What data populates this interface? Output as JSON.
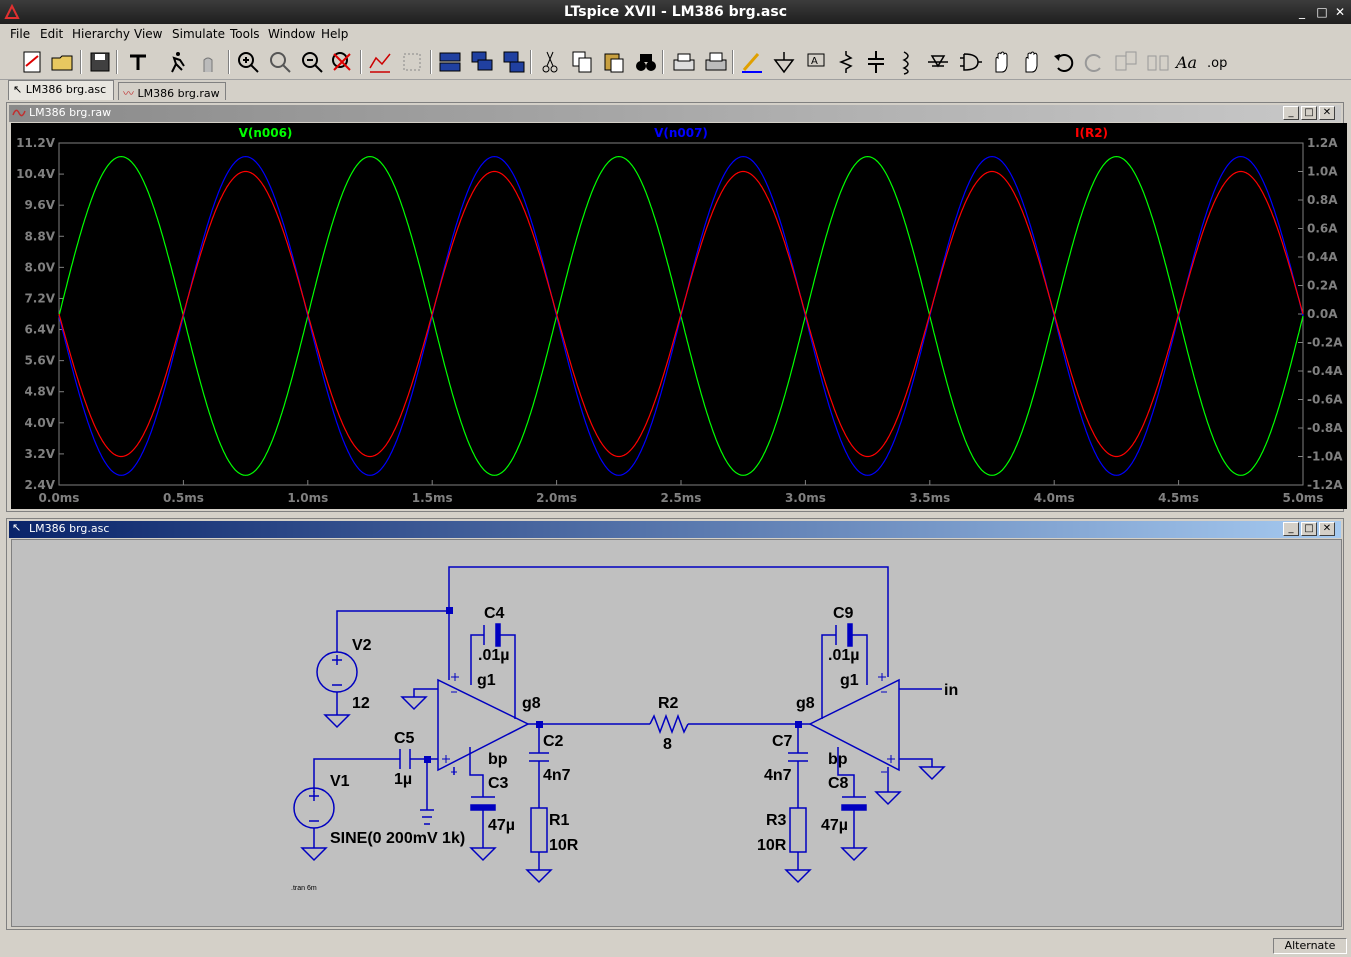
{
  "window": {
    "title": "LTspice XVII - LM386 brg.asc"
  },
  "menu": [
    "File",
    "Edit",
    "Hierarchy",
    "View",
    "Simulate",
    "Tools",
    "Window",
    "Help"
  ],
  "tabs": [
    {
      "label": "LM386 brg.asc",
      "active": true
    },
    {
      "label": "LM386 brg.raw",
      "active": false
    }
  ],
  "toolbar_icons": [
    "new-schematic-icon",
    "open-icon",
    "save-icon",
    "control-panel-icon",
    "run-icon",
    "halt-icon",
    "zoom-in-icon",
    "zoom-fit-icon",
    "zoom-out-icon",
    "zoom-cancel-icon",
    "autorange-icon",
    "delete-plot-icon",
    "tile-horizontal-icon",
    "cascade-icon",
    "tile-vertical-icon",
    "cut-icon",
    "copy-icon",
    "paste-icon",
    "find-icon",
    "print-icon",
    "print-setup-icon",
    "draw-wire-icon",
    "ground-icon",
    "label-net-icon",
    "resistor-icon",
    "capacitor-icon",
    "inductor-icon",
    "diode-icon",
    "component-icon",
    "move-icon",
    "drag-icon",
    "undo-icon",
    "redo-icon",
    "rotate-icon",
    "mirror-icon",
    "text-icon",
    "spice-directive-icon"
  ],
  "waveform": {
    "title": "LM386 brg.raw",
    "traces": [
      {
        "name": "V(n006)",
        "color": "#00ff00"
      },
      {
        "name": "V(n007)",
        "color": "#0000ff"
      },
      {
        "name": "I(R2)",
        "color": "#ff0000"
      }
    ]
  },
  "chart_data": {
    "type": "line",
    "x_unit": "ms",
    "xlim": [
      0,
      5
    ],
    "x_ticks": [
      "0.0ms",
      "0.5ms",
      "1.0ms",
      "1.5ms",
      "2.0ms",
      "2.5ms",
      "3.0ms",
      "3.5ms",
      "4.0ms",
      "4.5ms",
      "5.0ms"
    ],
    "y_left_ticks": [
      "11.2V",
      "10.4V",
      "9.6V",
      "8.8V",
      "8.0V",
      "7.2V",
      "6.4V",
      "5.6V",
      "4.8V",
      "4.0V",
      "3.2V",
      "2.4V"
    ],
    "y_left_lim": [
      2.4,
      11.2
    ],
    "y_right_ticks": [
      "1.2A",
      "1.0A",
      "0.8A",
      "0.6A",
      "0.4A",
      "0.2A",
      "0.0A",
      "-0.2A",
      "-0.4A",
      "-0.6A",
      "-0.8A",
      "-1.0A",
      "-1.2A"
    ],
    "y_right_lim": [
      -1.2,
      1.2
    ],
    "grid": false,
    "series": [
      {
        "name": "V(n006)",
        "axis": "left",
        "frequency_khz": 1,
        "offset": 6.75,
        "amplitude": 4.1,
        "phase": "sine",
        "color": "#00ff00"
      },
      {
        "name": "V(n007)",
        "axis": "left",
        "frequency_khz": 1,
        "offset": 6.75,
        "amplitude": 4.1,
        "phase": "inverted",
        "color": "#0000ff"
      },
      {
        "name": "I(R2)",
        "axis": "right",
        "frequency_khz": 1,
        "offset": 0,
        "amplitude": 1.0,
        "phase": "inverted",
        "color": "#ff0000"
      }
    ]
  },
  "schematic": {
    "title": "LM386 brg.asc",
    "labels": {
      "V2": "V2",
      "V2_val": "12",
      "V1": "V1",
      "V1_val": "SINE(0 200mV 1k)",
      "C5": "C5",
      "C5_val": "1µ",
      "C4": "C4",
      "C4_val": ".01µ",
      "C9": "C9",
      "C9_val": ".01µ",
      "g1a": "g1",
      "g8a": "g8",
      "bpa": "bp",
      "g1b": "g1",
      "g8b": "g8",
      "bpb": "bp",
      "C2": "C2",
      "C2_val": "4n7",
      "C3": "C3",
      "C3_val": "47µ",
      "R1": "R1",
      "R1_val": "10R",
      "R2": "R2",
      "R2_val": "8",
      "C7": "C7",
      "C7_val": "4n7",
      "R3": "R3",
      "R3_val": "10R",
      "C8": "C8",
      "C8_val": "47µ",
      "in": "in",
      "tran": ".tran 6m"
    }
  },
  "status": {
    "mode": "Alternate"
  }
}
